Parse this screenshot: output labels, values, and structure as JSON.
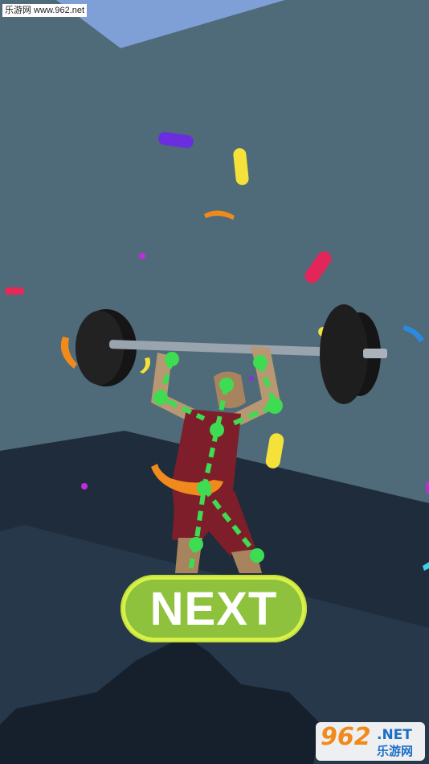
{
  "watermark": {
    "top_text": "乐游网 www.962.net"
  },
  "next_button": {
    "label": "NEXT"
  },
  "logo": {
    "number": "962",
    "suffix": ".NET",
    "chinese": "乐游网"
  },
  "colors": {
    "wall": "#4f6a78",
    "floor": "#1f2c3b",
    "ceiling": "#7fa0d6",
    "button_outer": "#d8f14a",
    "button_inner": "#8fc23c",
    "skeleton": "#3ddc52"
  }
}
